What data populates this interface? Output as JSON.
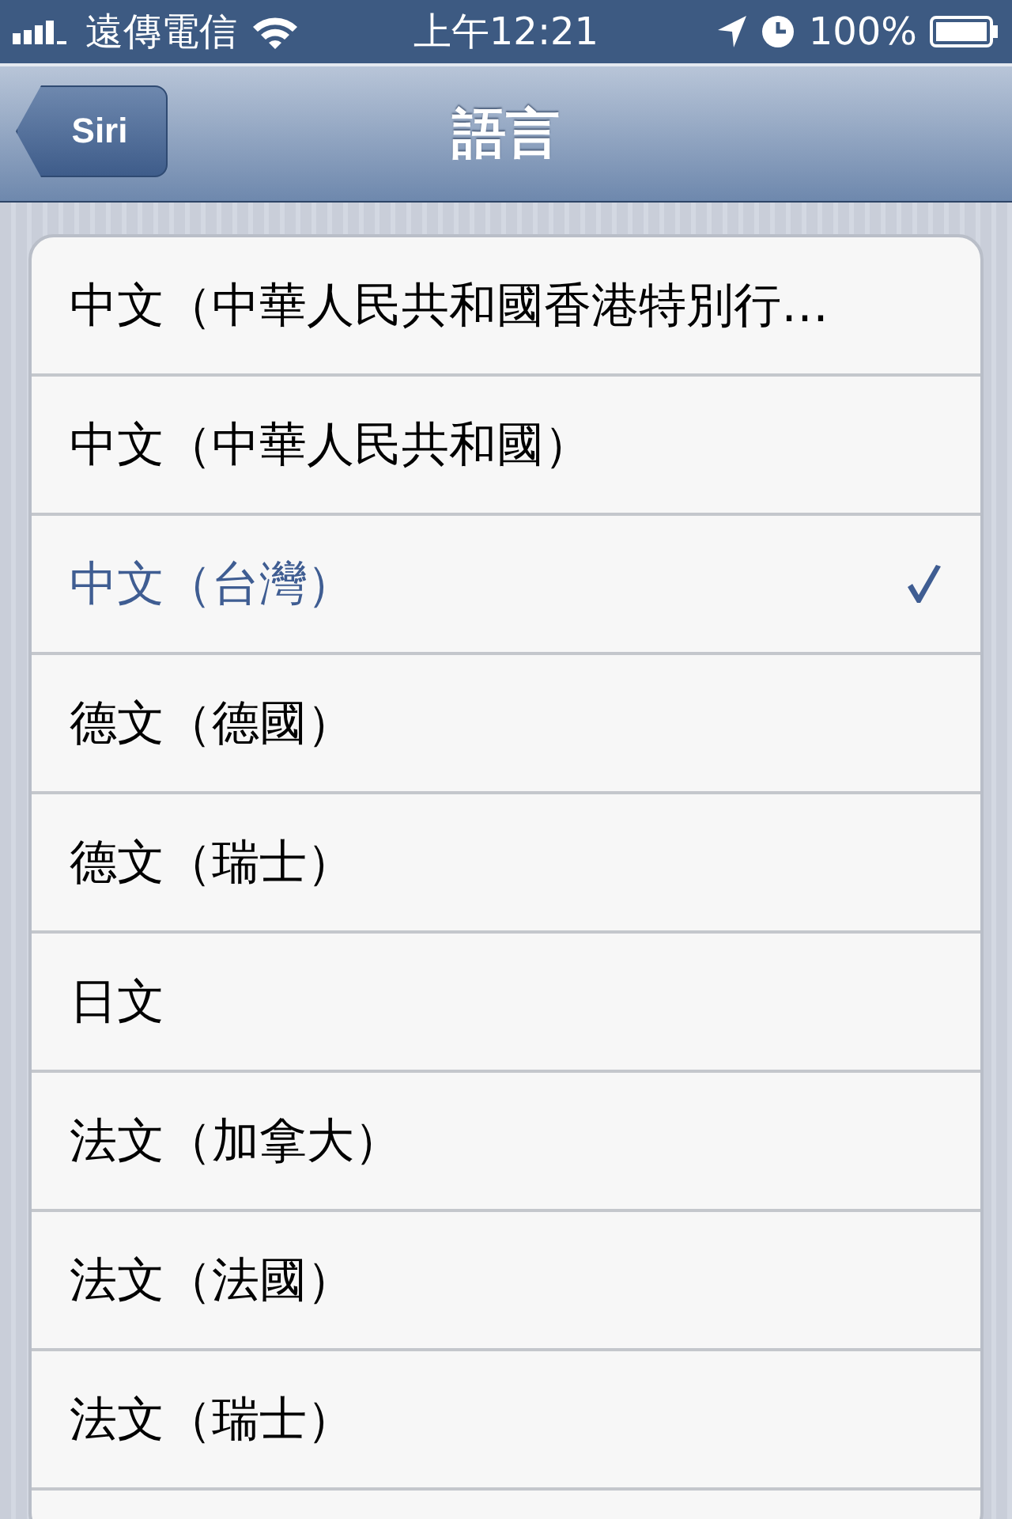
{
  "status_bar": {
    "carrier": "遠傳電信",
    "time": "上午12:21",
    "battery": "100%"
  },
  "nav_bar": {
    "back": "Siri",
    "title": "語言"
  },
  "languages": [
    {
      "label": "中文（中華人民共和國香港特別行…",
      "selected": false
    },
    {
      "label": "中文（中華人民共和國）",
      "selected": false
    },
    {
      "label": "中文（台灣）",
      "selected": true
    },
    {
      "label": "德文（德國）",
      "selected": false
    },
    {
      "label": "德文（瑞士）",
      "selected": false
    },
    {
      "label": "日文",
      "selected": false
    },
    {
      "label": "法文（加拿大）",
      "selected": false
    },
    {
      "label": "法文（法國）",
      "selected": false
    },
    {
      "label": "法文（瑞士）",
      "selected": false
    }
  ]
}
